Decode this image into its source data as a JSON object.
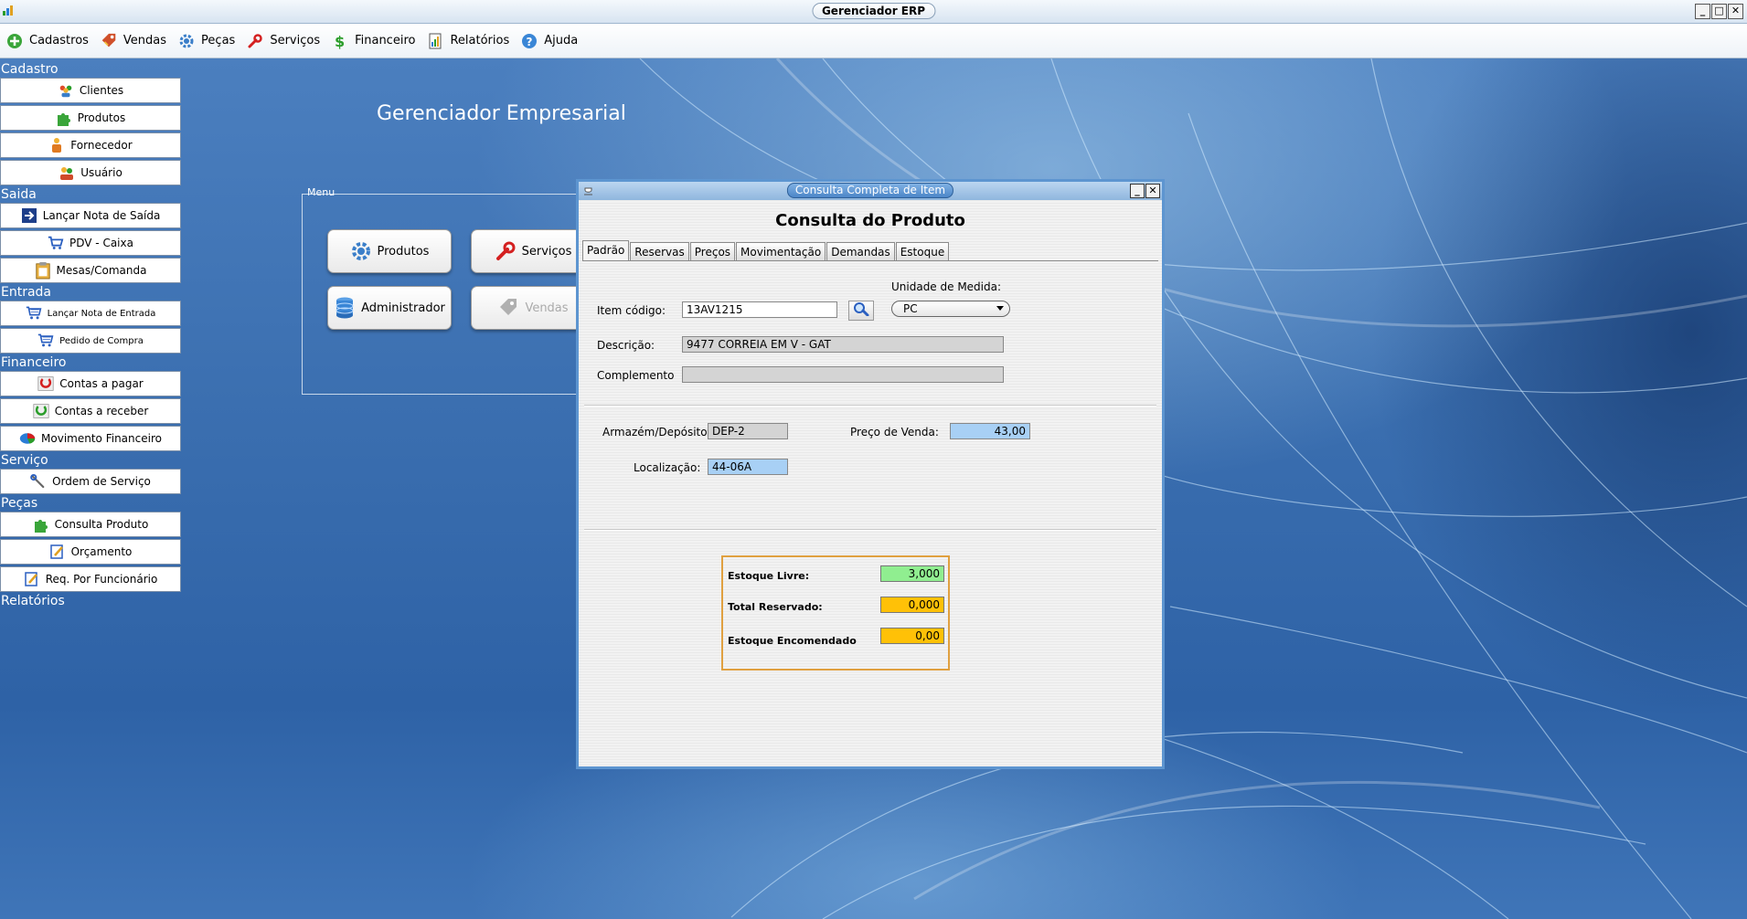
{
  "window": {
    "title": "Gerenciador ERP"
  },
  "menubar": [
    {
      "label": "Cadastros"
    },
    {
      "label": "Vendas"
    },
    {
      "label": "Peças"
    },
    {
      "label": "Serviços"
    },
    {
      "label": "Financeiro"
    },
    {
      "label": "Relatórios"
    },
    {
      "label": "Ajuda"
    }
  ],
  "sidebar": {
    "cadastro": {
      "title": "Cadastro",
      "items": [
        "Clientes",
        "Produtos",
        "Fornecedor",
        "Usuário"
      ]
    },
    "saida": {
      "title": "Saida",
      "items": [
        "Lançar Nota de Saída",
        "PDV - Caixa",
        "Mesas/Comanda"
      ]
    },
    "entrada": {
      "title": "Entrada",
      "items": [
        "Lançar Nota de Entrada",
        "Pedido de Compra"
      ]
    },
    "financeiro": {
      "title": "Financeiro",
      "items": [
        "Contas a pagar",
        "Contas a receber",
        "Movimento Financeiro"
      ]
    },
    "servico": {
      "title": "Serviço",
      "items": [
        "Ordem de Serviço"
      ]
    },
    "pecas": {
      "title": "Peças",
      "items": [
        "Consulta Produto",
        "Orçamento",
        "Req. Por Funcionário"
      ]
    },
    "relatorios": {
      "title": "Relatórios"
    }
  },
  "main": {
    "title": "Gerenciador Empresarial",
    "menu_legend": "Menu",
    "buttons": {
      "produtos": "Produtos",
      "servicos": "Serviços",
      "administrador": "Administrador",
      "vendas": "Vendas"
    }
  },
  "dialog": {
    "title": "Consulta Completa de Item",
    "heading": "Consulta do Produto",
    "tabs": [
      "Padrão",
      "Reservas",
      "Preços",
      "Movimentação",
      "Demandas",
      "Estoque"
    ],
    "active_tab": "Padrão",
    "item_codigo_label": "Item código:",
    "item_codigo": "13AV1215",
    "unidade_label": "Unidade de Medida:",
    "unidade": "PC",
    "descricao_label": "Descrição:",
    "descricao": "9477 CORREIA EM V - GAT",
    "complemento_label": "Complemento",
    "complemento": "",
    "armazem_label": "Armazém/Depósito",
    "armazem": "DEP-2",
    "preco_label": "Preço de Venda:",
    "preco": "43,00",
    "localizacao_label": "Localização:",
    "localizacao": "44-06A",
    "estoque_livre_label": "Estoque Livre:",
    "estoque_livre": "3,000",
    "total_reservado_label": "Total Reservado:",
    "total_reservado": "0,000",
    "estoque_encomendado_label": "Estoque Encomendado",
    "estoque_encomendado": "0,00"
  },
  "colors": {
    "desktop": "#3b6fb0",
    "dialog_border": "#5d95d0",
    "field_blue": "#a8d0f5",
    "field_green": "#90ee90",
    "field_yellow": "#ffc107",
    "stock_border": "#e0a040"
  }
}
